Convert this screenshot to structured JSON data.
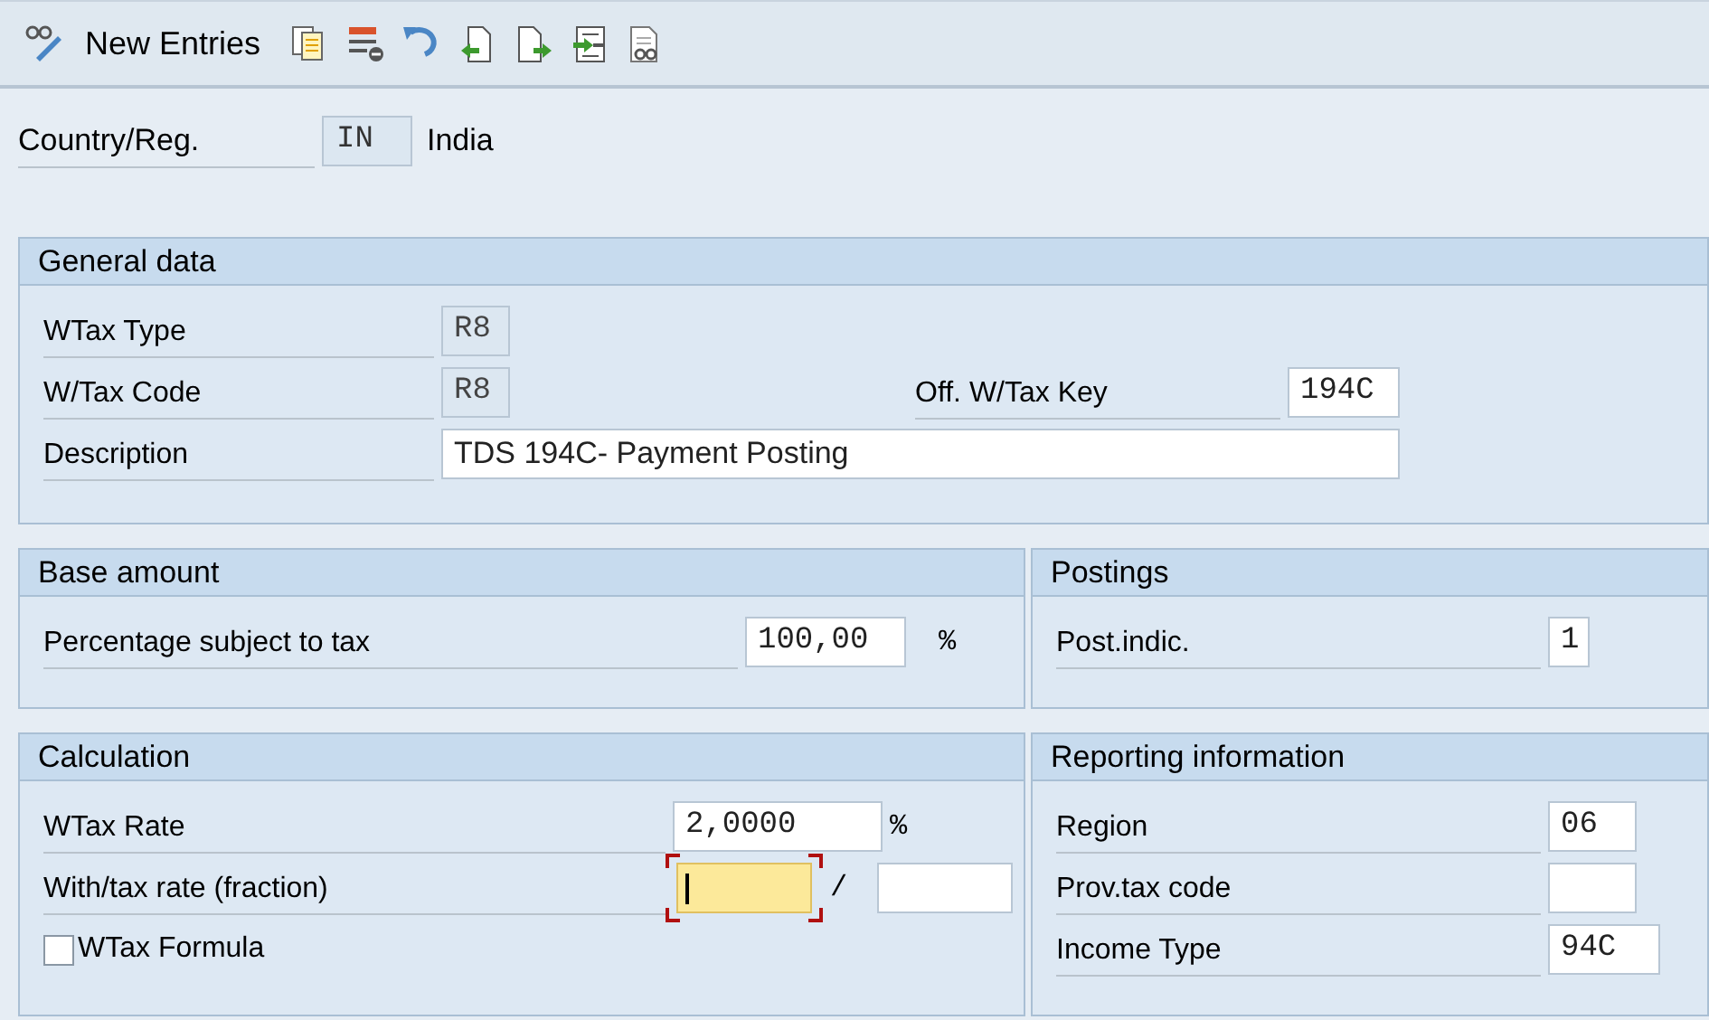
{
  "toolbar": {
    "title": "New Entries"
  },
  "country": {
    "label": "Country/Reg.",
    "code": "IN",
    "name": "India"
  },
  "sections": [
    {
      "title": "General data",
      "rows": [
        {
          "cells": [
            {
              "kind": "label",
              "text": "WTax Type"
            },
            {
              "kind": "field",
              "value": "R8",
              "readonly": true,
              "focused": false
            }
          ]
        },
        {
          "cells": [
            {
              "kind": "label",
              "text": "W/Tax Code"
            },
            {
              "kind": "field",
              "value": "R8",
              "readonly": true,
              "focused": false
            },
            {
              "kind": "label",
              "text": "Off. W/Tax Key"
            },
            {
              "kind": "field",
              "value": "194C",
              "readonly": false,
              "focused": false
            }
          ]
        },
        {
          "cells": [
            {
              "kind": "label",
              "text": "Description"
            },
            {
              "kind": "field",
              "value": "TDS 194C- Payment Posting",
              "readonly": false,
              "focused": false,
              "proportional": true
            }
          ]
        }
      ]
    },
    {
      "title": "Base amount",
      "rows": [
        {
          "cells": [
            {
              "kind": "label",
              "text": "Percentage subject to tax"
            },
            {
              "kind": "field",
              "value": "100,00",
              "readonly": false,
              "focused": false
            },
            {
              "kind": "unit",
              "text": "%"
            }
          ]
        }
      ]
    },
    {
      "title": "Postings",
      "rows": [
        {
          "cells": [
            {
              "kind": "label",
              "text": "Post.indic."
            },
            {
              "kind": "field",
              "value": "1",
              "readonly": false,
              "focused": false
            }
          ]
        }
      ]
    },
    {
      "title": "Calculation",
      "rows": [
        {
          "cells": [
            {
              "kind": "label",
              "text": "WTax Rate"
            },
            {
              "kind": "field",
              "value": "2,0000",
              "readonly": false,
              "focused": false
            },
            {
              "kind": "unit",
              "text": "%"
            }
          ]
        },
        {
          "cells": [
            {
              "kind": "label",
              "text": "With/tax rate (fraction)"
            },
            {
              "kind": "field",
              "readonly": false,
              "focused": true
            },
            {
              "kind": "unit",
              "text": "/"
            },
            {
              "kind": "field",
              "readonly": false,
              "focused": false
            }
          ]
        },
        {
          "cells": [
            {
              "kind": "checkbox",
              "text": "WTax Formula",
              "checked": false
            }
          ]
        }
      ]
    },
    {
      "title": "Reporting information",
      "rows": [
        {
          "cells": [
            {
              "kind": "label",
              "text": "Region"
            },
            {
              "kind": "field",
              "value": "06",
              "readonly": false,
              "focused": false
            }
          ]
        },
        {
          "cells": [
            {
              "kind": "label",
              "text": "Prov.tax code"
            },
            {
              "kind": "field",
              "readonly": false,
              "focused": false
            }
          ]
        },
        {
          "cells": [
            {
              "kind": "label",
              "text": "Income Type"
            },
            {
              "kind": "field",
              "value": "94C",
              "readonly": false,
              "focused": false
            }
          ]
        }
      ]
    }
  ]
}
